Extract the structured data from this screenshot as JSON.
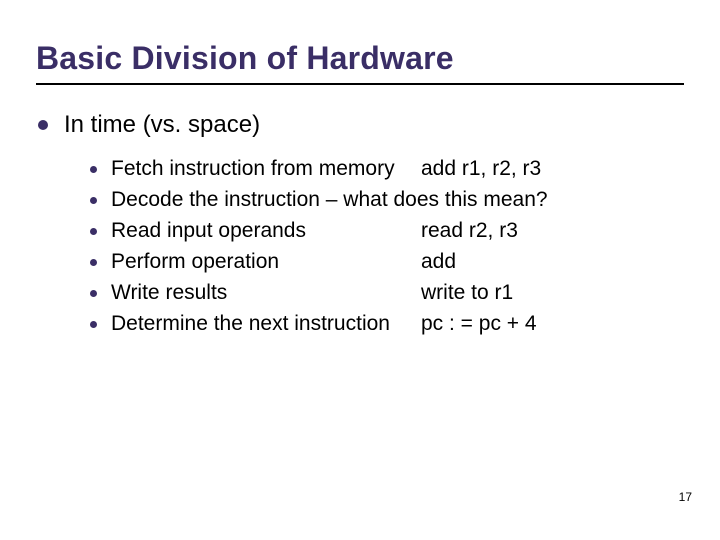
{
  "title": "Basic Division of Hardware",
  "l1": "In time (vs. space)",
  "sub": [
    {
      "left": "Fetch instruction from memory",
      "right": "add r1, r2, r3"
    },
    {
      "full": "Decode the instruction – what does this mean?"
    },
    {
      "left": "Read input operands",
      "right": "read r2, r3"
    },
    {
      "left": "Perform operation",
      "right": "add"
    },
    {
      "left": "Write results",
      "right": "write to r1"
    },
    {
      "left": "Determine the next instruction",
      "right": "pc : = pc + 4"
    }
  ],
  "pageNumber": "17"
}
